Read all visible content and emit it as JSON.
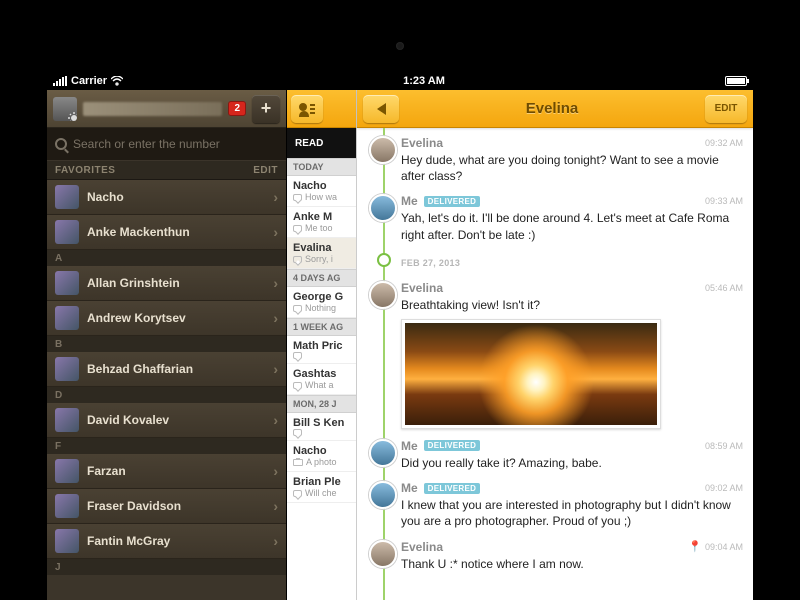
{
  "statusbar": {
    "carrier": "Carrier",
    "time": "1:23 AM"
  },
  "contacts": {
    "badge": "2",
    "search_placeholder": "Search or enter the number",
    "favorites_label": "FAVORITES",
    "edit_label": "EDIT",
    "favorites": [
      {
        "name": "Nacho"
      },
      {
        "name": "Anke Mackenthun"
      }
    ],
    "index": [
      {
        "letter": "A",
        "items": [
          "Allan Grinshtein",
          "Andrew Korytsev"
        ]
      },
      {
        "letter": "B",
        "items": [
          "Behzad Ghaffarian"
        ]
      },
      {
        "letter": "D",
        "items": [
          "David Kovalev"
        ]
      },
      {
        "letter": "F",
        "items": [
          "Farzan",
          "Fraser Davidson",
          "Fantin McGray"
        ]
      },
      {
        "letter": "J",
        "items": []
      }
    ]
  },
  "preview": {
    "read_all_label": "READ",
    "sections": [
      {
        "label": "TODAY",
        "items": [
          {
            "name": "Nacho",
            "sub": "How wa",
            "icon": "bubble"
          },
          {
            "name": "Anke M",
            "sub": "Me too",
            "icon": "bubble"
          },
          {
            "name": "Evalina",
            "sub": "Sorry, i",
            "icon": "bubble",
            "selected": true
          }
        ]
      },
      {
        "label": "4 DAYS AG",
        "items": [
          {
            "name": "George G",
            "sub": "Nothing",
            "icon": "bubble"
          }
        ]
      },
      {
        "label": "1 WEEK AG",
        "items": [
          {
            "name": "Math Pric",
            "sub": "",
            "icon": "bubble"
          },
          {
            "name": "Gashtas",
            "sub": "What a",
            "icon": "bubble"
          }
        ]
      },
      {
        "label": "MON, 28 J",
        "items": [
          {
            "name": "Bill S Ken",
            "sub": "",
            "icon": "bubble"
          },
          {
            "name": "Nacho",
            "sub": "A photo",
            "icon": "camera"
          },
          {
            "name": "Brian Ple",
            "sub": "Will che",
            "icon": "bubble"
          }
        ]
      }
    ]
  },
  "chat": {
    "title": "Evelina",
    "edit_label": "EDIT",
    "delivered_label": "DELIVERED",
    "me_label": "Me",
    "messages": [
      {
        "who": "Evelina",
        "time": "09:32 AM",
        "text": "Hey dude, what are you doing tonight? Want to see a movie after class?",
        "avatar": "them"
      },
      {
        "who": "Me",
        "time": "09:33 AM",
        "text": "Yah, let's do it. I'll be done around 4. Let's meet at Cafe Roma right after. Don't be late :)",
        "delivered": true,
        "avatar": "me"
      }
    ],
    "date_sep": "FEB 27, 2013",
    "messages2": [
      {
        "who": "Evelina",
        "time": "05:46 AM",
        "text": "Breathtaking view! Isn't it?",
        "avatar": "them",
        "photo": true
      },
      {
        "who": "Me",
        "time": "08:59 AM",
        "text": "Did you really take it? Amazing, babe.",
        "delivered": true,
        "avatar": "me"
      },
      {
        "who": "Me",
        "time": "09:02 AM",
        "text": "I knew that you are interested in photography but I didn't know you are a pro photographer. Proud of you ;)",
        "delivered": true,
        "avatar": "me"
      },
      {
        "who": "Evelina",
        "time": "09:04 AM",
        "text": "Thank U :* notice where I am now.",
        "avatar": "them",
        "pin": true
      }
    ]
  }
}
